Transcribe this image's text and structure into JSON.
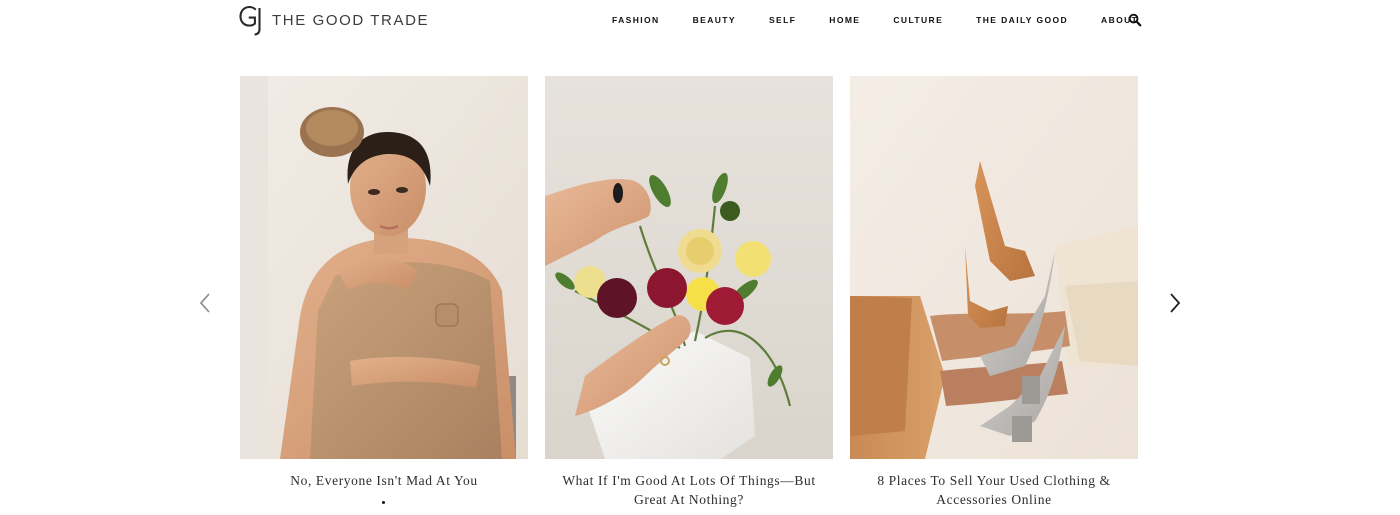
{
  "brand": {
    "name": "THE GOOD TRADE",
    "logo_mark": "GJ-monogram-icon"
  },
  "nav": {
    "items": [
      {
        "label": "FASHION"
      },
      {
        "label": "BEAUTY"
      },
      {
        "label": "SELF"
      },
      {
        "label": "HOME"
      },
      {
        "label": "CULTURE"
      },
      {
        "label": "THE DAILY GOOD"
      },
      {
        "label": "ABOUT"
      }
    ],
    "search_icon": "search-icon"
  },
  "carousel": {
    "prev_icon": "chevron-left-icon",
    "next_icon": "chevron-right-icon",
    "cards": [
      {
        "title": "No, Everyone Isn't Mad At You",
        "image": "woman-hugging-tan-leather-bag-photo"
      },
      {
        "title": "What If I'm Good At Lots Of Things—But Great At Nothing?",
        "image": "hands-arranging-flowers-in-white-vase-photo"
      },
      {
        "title": "8 Places To Sell Your Used Clothing & Accessories Online",
        "image": "legs-in-tan-and-grey-heeled-boots-photo"
      }
    ]
  },
  "colors": {
    "text": "#111111",
    "logo_text": "#3c3c3c",
    "title_text": "#2d2d2d",
    "arrow_prev": "#8a8a8a",
    "arrow_next": "#222222"
  }
}
